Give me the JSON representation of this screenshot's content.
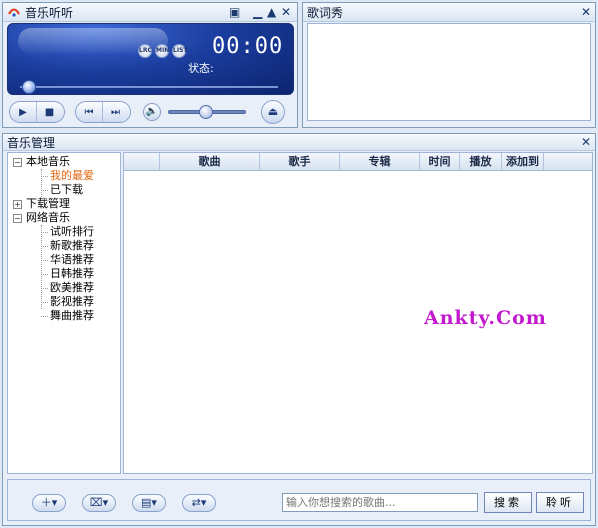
{
  "player": {
    "title": "音乐听听",
    "time": "00:00",
    "status_label": "状态:",
    "mini_buttons": [
      "LRC",
      "MIN",
      "LIST"
    ],
    "progress_percent": 0,
    "volume_percent": 50
  },
  "lyrics": {
    "title": "歌词秀"
  },
  "manager": {
    "title": "音乐管理",
    "tree": {
      "local": {
        "label": "本地音乐",
        "children": [
          "我的最爱",
          "已下载"
        ]
      },
      "download": {
        "label": "下载管理"
      },
      "online": {
        "label": "网络音乐",
        "children": [
          "试听排行",
          "新歌推荐",
          "华语推荐",
          "日韩推荐",
          "欧美推荐",
          "影视推荐",
          "舞曲推荐"
        ]
      }
    },
    "columns": [
      "歌曲",
      "歌手",
      "专辑",
      "时间",
      "播放",
      "添加到"
    ],
    "watermark": "Ankty.Com",
    "search_placeholder": "输入你想搜索的歌曲...",
    "search_button": "搜索",
    "listen_button": "聆听"
  },
  "colors": {
    "selected_text": "#e0640c",
    "watermark": "#c21bcd",
    "screen": "#1b3d9e"
  }
}
